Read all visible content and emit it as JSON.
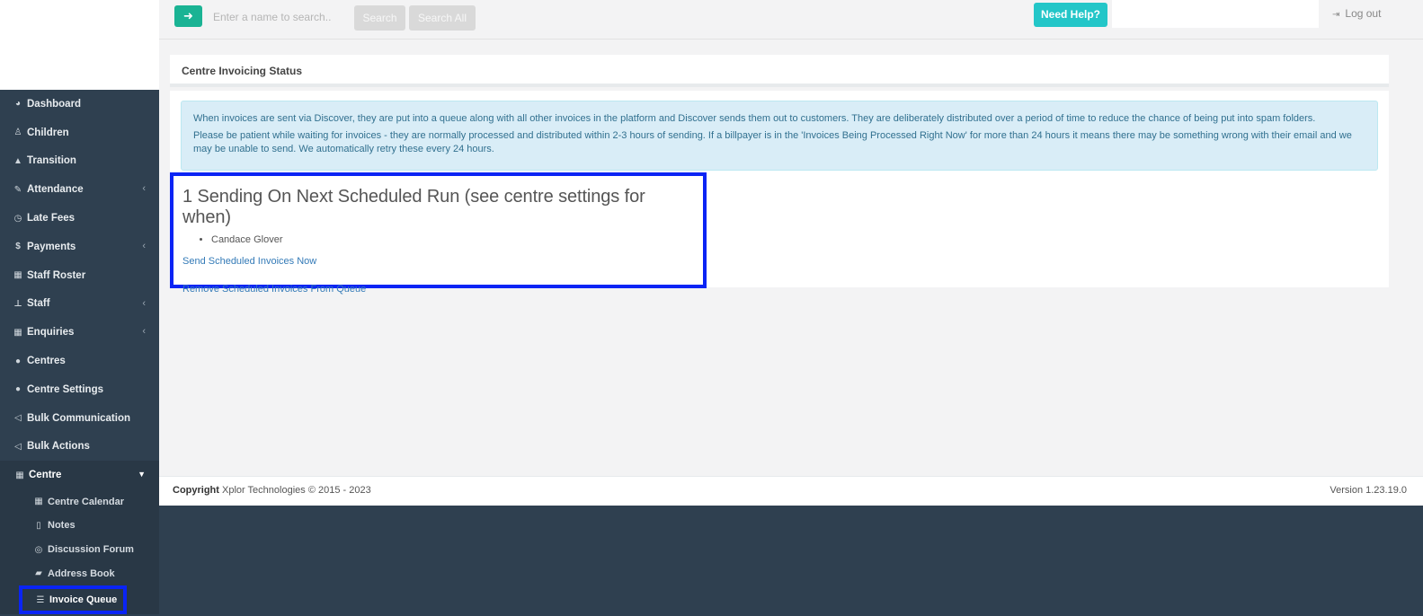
{
  "topbar": {
    "search_placeholder": "Enter a name to search..",
    "search_label": "Search",
    "search_all_label": "Search All",
    "help_label": "Need Help?",
    "logout_label": "Log out"
  },
  "sidebar": {
    "items": [
      {
        "label": "Dashboard",
        "icon": "palette-icon"
      },
      {
        "label": "Children",
        "icon": "child-icon"
      },
      {
        "label": "Transition",
        "icon": "graduation-cap-icon"
      },
      {
        "label": "Attendance",
        "icon": "edit-icon",
        "has_children": true
      },
      {
        "label": "Late Fees",
        "icon": "clock-icon"
      },
      {
        "label": "Payments",
        "icon": "dollar-icon",
        "has_children": true
      },
      {
        "label": "Staff Roster",
        "icon": "calendar-icon"
      },
      {
        "label": "Staff",
        "icon": "sitemap-icon",
        "has_children": true
      },
      {
        "label": "Enquiries",
        "icon": "th-large-icon",
        "has_children": true
      },
      {
        "label": "Centres",
        "icon": "circle-icon"
      },
      {
        "label": "Centre Settings",
        "icon": "circle-icon"
      },
      {
        "label": "Bulk Communication",
        "icon": "bullhorn-icon"
      },
      {
        "label": "Bulk Actions",
        "icon": "bullhorn-icon"
      }
    ],
    "active_group": {
      "label": "Centre",
      "icon": "th-large-icon",
      "expanded": true
    },
    "sub_items": [
      {
        "label": "Centre Calendar",
        "icon": "calendar-icon"
      },
      {
        "label": "Notes",
        "icon": "file-icon"
      },
      {
        "label": "Discussion Forum",
        "icon": "comments-icon"
      },
      {
        "label": "Address Book",
        "icon": "book-icon"
      },
      {
        "label": "Invoice Queue",
        "icon": "list-icon",
        "selected": true
      }
    ]
  },
  "main": {
    "panel_title": "Centre Invoicing Status",
    "alert_line1": "When invoices are sent via Discover, they are put into a queue along with all other invoices in the platform and Discover sends them out to customers. They are deliberately distributed over a period of time to reduce the chance of being put into spam folders.",
    "alert_line2": "Please be patient while waiting for invoices - they are normally processed and distributed within 2-3 hours of sending. If a billpayer is in the 'Invoices Being Processed Right Now' for more than 24 hours it means there may be something wrong with their email and we may be unable to send. We automatically retry these every 24 hours.",
    "queue_heading": "1 Sending On Next Scheduled Run (see centre settings for when)",
    "queue_names": [
      "Candace Glover"
    ],
    "send_link": "Send Scheduled Invoices Now",
    "remove_link": "Remove Scheduled Invoices From Queue"
  },
  "footer": {
    "copyright_label": "Copyright",
    "copyright_text": " Xplor Technologies © 2015 - 2023",
    "version": "Version 1.23.19.0"
  },
  "colors": {
    "sidebar_bg": "#2f4050",
    "primary": "#1ab394",
    "help": "#23c6c8",
    "alert_bg": "#d9edf7",
    "link": "#337ab7",
    "highlight": "#0a24f5"
  }
}
